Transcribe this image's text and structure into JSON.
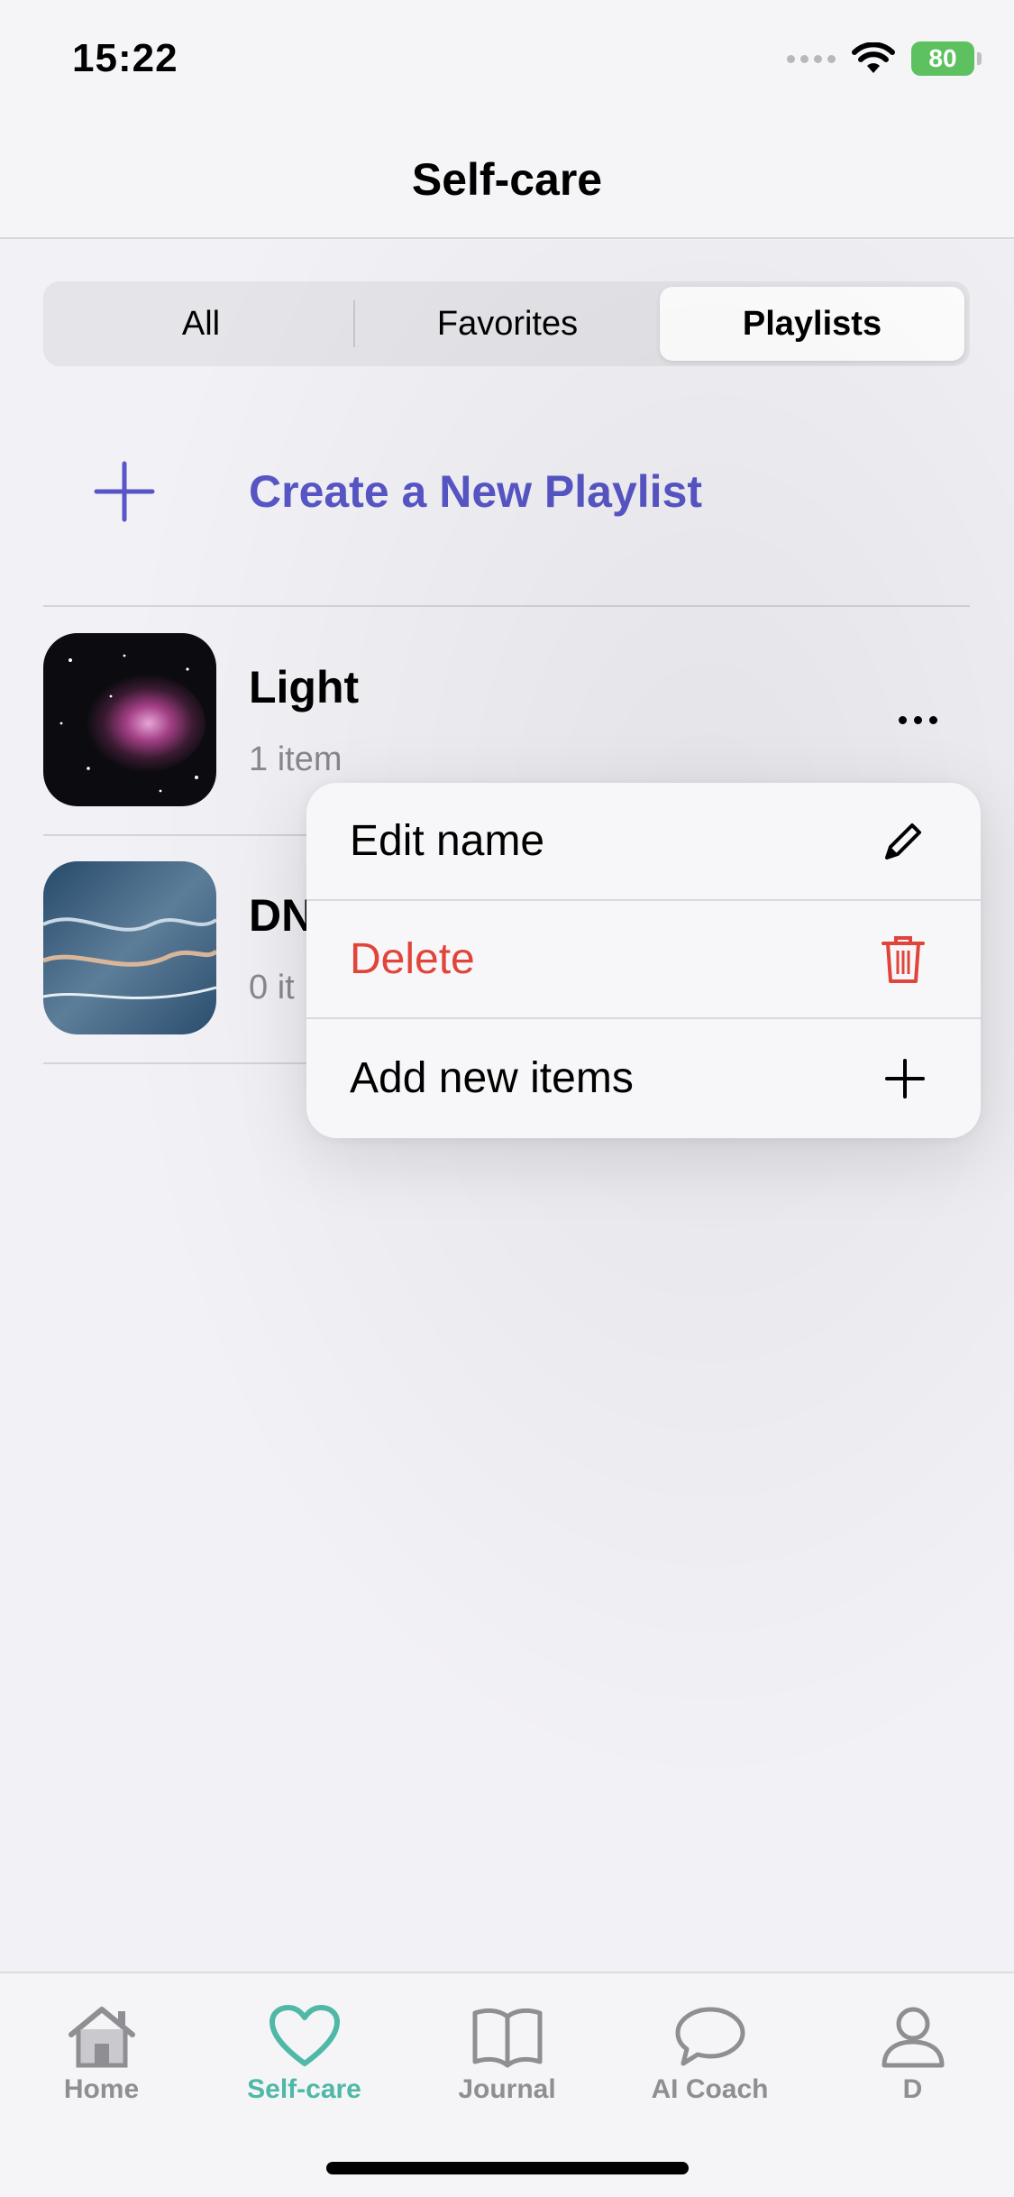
{
  "status_bar": {
    "time": "15:22",
    "battery": "80"
  },
  "header": {
    "title": "Self-care"
  },
  "segments": [
    {
      "label": "All",
      "active": false
    },
    {
      "label": "Favorites",
      "active": false
    },
    {
      "label": "Playlists",
      "active": true
    }
  ],
  "create": {
    "label": "Create a New Playlist",
    "icon": "plus-icon"
  },
  "playlists": [
    {
      "title": "Light",
      "subtitle": "1 item",
      "thumbnail": "nebula-image"
    },
    {
      "title": "DN",
      "subtitle": "0 it",
      "thumbnail": "ocean-waves-image"
    }
  ],
  "context_menu": {
    "items": [
      {
        "label": "Edit name",
        "icon": "pencil-icon",
        "color": "#000000"
      },
      {
        "label": "Delete",
        "icon": "trash-icon",
        "color": "#e0443a"
      },
      {
        "label": "Add new items",
        "icon": "plus-icon",
        "color": "#000000"
      }
    ]
  },
  "tab_bar": {
    "tabs": [
      {
        "label": "Home",
        "icon": "house-icon",
        "active": false
      },
      {
        "label": "Self-care",
        "icon": "heart-icon",
        "active": true
      },
      {
        "label": "Journal",
        "icon": "book-icon",
        "active": false
      },
      {
        "label": "AI Coach",
        "icon": "chat-bubble-icon",
        "active": false
      },
      {
        "label": "D",
        "icon": "person-icon",
        "active": false
      }
    ]
  },
  "colors": {
    "accent": "#5856c6",
    "tab_active": "#4fb8a7",
    "destructive": "#e0443a"
  }
}
